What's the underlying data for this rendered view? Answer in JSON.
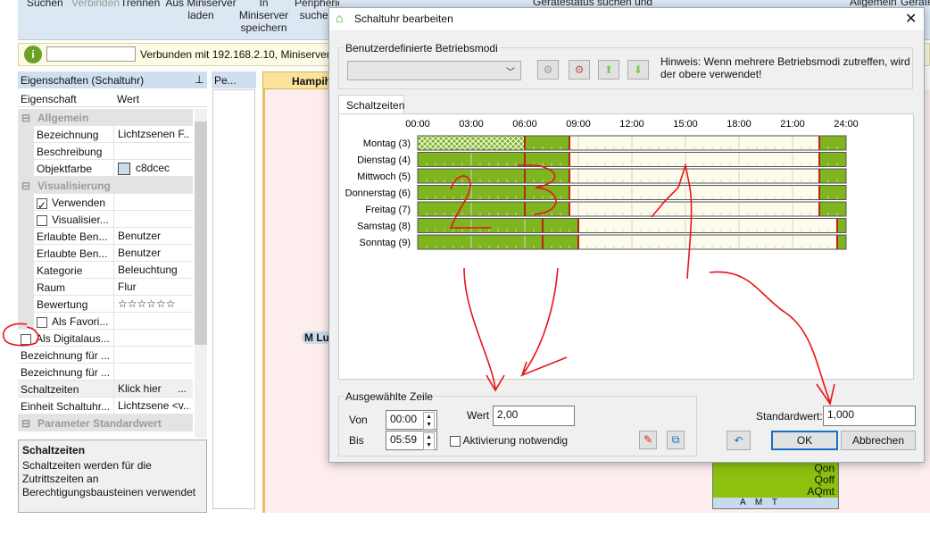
{
  "ribbon": {
    "items": [
      "Suchen",
      "Verbinden",
      "Trennen",
      "Aus Miniserver laden",
      "In Miniserver speichern",
      "Peripherie suchen",
      "Gerätestatus suchen und",
      "Allgemein",
      "Geräte"
    ]
  },
  "infobar": {
    "status": "Verbunden mit 192.168.2.10, Miniserver: S",
    "search_value": ""
  },
  "properties": {
    "title": "Eigenschaften (Schaltuhr)",
    "col_property": "Eigenschaft",
    "col_value": "Wert",
    "rows": [
      {
        "type": "category",
        "label": "Allgemein"
      },
      {
        "label": "Bezeichnung",
        "value": "Lichtzsenen F..."
      },
      {
        "label": "Beschreibung",
        "value": ""
      },
      {
        "label": "Objektfarbe",
        "value": "c8dcec",
        "swatch": "#c8dcec"
      },
      {
        "type": "category",
        "label": "Visualisierung"
      },
      {
        "label": "Verwenden",
        "checkbox": true,
        "checked": true
      },
      {
        "label": "Visualisier...",
        "checkbox": true,
        "checked": false
      },
      {
        "label": "Erlaubte Ben...",
        "value": "Benutzer"
      },
      {
        "label": "Erlaubte Ben...",
        "value": "Benutzer"
      },
      {
        "label": "Kategorie",
        "value": "Beleuchtung"
      },
      {
        "label": "Raum",
        "value": "Flur"
      },
      {
        "label": "Bewertung",
        "value": "☆☆☆☆☆☆"
      },
      {
        "label": "Als Favori...",
        "checkbox": true,
        "checked": false
      },
      {
        "label": "Als Digitalaus...",
        "checkbox": true,
        "checked": false,
        "outer": true
      },
      {
        "label": "Bezeichnung für ...",
        "value": "",
        "outer": true
      },
      {
        "label": "Bezeichnung für ...",
        "value": "",
        "outer": true
      },
      {
        "label": "Schaltzeiten",
        "value": "Klick hier",
        "ellipsis": "...",
        "outer": true,
        "selected": true
      },
      {
        "label": "Einheit Schaltuhr...",
        "value": "Lichtzsene <v...",
        "outer": true
      },
      {
        "type": "category",
        "label": "Parameter Standardwert"
      }
    ],
    "help_title": "Schaltzeiten",
    "help_text": "Schaltzeiten werden für die Zutrittszeiten an Berechtigungsbausteinen verwendet"
  },
  "periphery": {
    "title": "Pe..."
  },
  "document_tab": {
    "label": "Hampih"
  },
  "canvas": {
    "block_outputs": [
      "Qon",
      "Qoff",
      "AQmt"
    ],
    "block_footer": [
      "A",
      "M",
      "T"
    ],
    "labels": [
      "M",
      "Lu"
    ]
  },
  "dialog": {
    "title": "Schaltuhr bearbeiten",
    "modes_group": "Benutzerdefinierte Betriebsmodi",
    "modes_selected": "",
    "hint": "Hinweis: Wenn mehrere Betriebsmodi zutreffen, wird der obere verwendet!",
    "tab": "Schaltzeiten",
    "selected_group": "Ausgewählte Zeile",
    "von_label": "Von",
    "von": "00:00",
    "bis_label": "Bis",
    "bis": "05:59",
    "wert_label": "Wert",
    "wert": "2,00",
    "aktivierung": "Aktivierung notwendig",
    "standard_label": "Standardwert:",
    "standard": "1,000",
    "ok": "OK",
    "cancel": "Abbrechen",
    "colors": {
      "active": "#7fb51f",
      "inactive": "#fdfbec",
      "divider": "#c0201a"
    }
  },
  "chart_data": {
    "type": "timeline",
    "x_ticks": [
      "00:00",
      "03:00",
      "06:00",
      "09:00",
      "12:00",
      "15:00",
      "18:00",
      "21:00",
      "24:00"
    ],
    "xlim": [
      0,
      24
    ],
    "days": [
      {
        "label": "Montag (3)",
        "segments": [
          {
            "start": 0,
            "end": 6,
            "active": true,
            "selected": true
          },
          {
            "start": 6,
            "end": 8.5,
            "active": true
          },
          {
            "start": 8.5,
            "end": 22.5,
            "active": false
          },
          {
            "start": 22.5,
            "end": 24,
            "active": true
          }
        ]
      },
      {
        "label": "Dienstag (4)",
        "segments": [
          {
            "start": 0,
            "end": 6,
            "active": true
          },
          {
            "start": 6,
            "end": 8.5,
            "active": true
          },
          {
            "start": 8.5,
            "end": 22.5,
            "active": false
          },
          {
            "start": 22.5,
            "end": 24,
            "active": true
          }
        ]
      },
      {
        "label": "Mittwoch (5)",
        "segments": [
          {
            "start": 0,
            "end": 6,
            "active": true
          },
          {
            "start": 6,
            "end": 8.5,
            "active": true
          },
          {
            "start": 8.5,
            "end": 22.5,
            "active": false
          },
          {
            "start": 22.5,
            "end": 24,
            "active": true
          }
        ]
      },
      {
        "label": "Donnerstag (6)",
        "segments": [
          {
            "start": 0,
            "end": 6,
            "active": true
          },
          {
            "start": 6,
            "end": 8.5,
            "active": true
          },
          {
            "start": 8.5,
            "end": 22.5,
            "active": false
          },
          {
            "start": 22.5,
            "end": 24,
            "active": true
          }
        ]
      },
      {
        "label": "Freitag (7)",
        "segments": [
          {
            "start": 0,
            "end": 6,
            "active": true
          },
          {
            "start": 6,
            "end": 8.5,
            "active": true
          },
          {
            "start": 8.5,
            "end": 22.5,
            "active": false
          },
          {
            "start": 22.5,
            "end": 24,
            "active": true
          }
        ]
      },
      {
        "label": "Samstag (8)",
        "segments": [
          {
            "start": 0,
            "end": 7,
            "active": true
          },
          {
            "start": 7,
            "end": 9,
            "active": true
          },
          {
            "start": 9,
            "end": 23.5,
            "active": false
          },
          {
            "start": 23.5,
            "end": 24,
            "active": true
          }
        ]
      },
      {
        "label": "Sonntag (9)",
        "segments": [
          {
            "start": 0,
            "end": 7,
            "active": true
          },
          {
            "start": 7,
            "end": 9,
            "active": true
          },
          {
            "start": 9,
            "end": 23.5,
            "active": false
          },
          {
            "start": 23.5,
            "end": 24,
            "active": true
          }
        ]
      }
    ]
  }
}
